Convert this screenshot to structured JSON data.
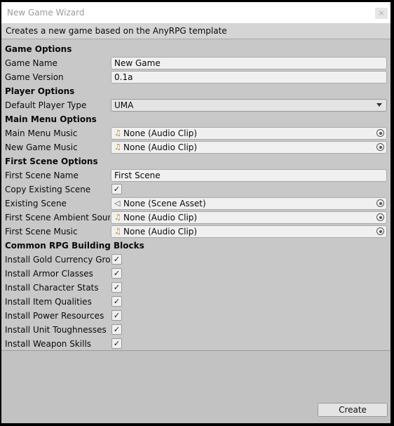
{
  "window": {
    "title": "New Game Wizard",
    "close_label": "×"
  },
  "help_text": "Creates a new game based on the AnyRPG template",
  "sections": {
    "game_options": "Game Options",
    "player_options": "Player Options",
    "main_menu_options": "Main Menu Options",
    "first_scene_options": "First Scene Options",
    "building_blocks": "Common RPG Building Blocks"
  },
  "fields": {
    "game_name": {
      "label": "Game Name",
      "value": "New Game"
    },
    "game_version": {
      "label": "Game Version",
      "value": "0.1a"
    },
    "default_player_type": {
      "label": "Default Player Type",
      "value": "UMA"
    },
    "main_menu_music": {
      "label": "Main Menu Music",
      "value": "None (Audio Clip)"
    },
    "new_game_music": {
      "label": "New Game Music",
      "value": "None (Audio Clip)"
    },
    "first_scene_name": {
      "label": "First Scene Name",
      "value": "First Scene"
    },
    "copy_existing_scene": {
      "label": "Copy Existing Scene",
      "checked": true
    },
    "existing_scene": {
      "label": "Existing Scene",
      "value": "None (Scene Asset)"
    },
    "first_scene_ambient": {
      "label": "First Scene Ambient Sounds",
      "value": "None (Audio Clip)"
    },
    "first_scene_music": {
      "label": "First Scene Music",
      "value": "None (Audio Clip)"
    }
  },
  "building_blocks": [
    {
      "label": "Install Gold Currency Group",
      "checked": true
    },
    {
      "label": "Install Armor Classes",
      "checked": true
    },
    {
      "label": "Install Character Stats",
      "checked": true
    },
    {
      "label": "Install Item Qualities",
      "checked": true
    },
    {
      "label": "Install Power Resources",
      "checked": true
    },
    {
      "label": "Install Unit Toughnesses",
      "checked": true
    },
    {
      "label": "Install Weapon Skills",
      "checked": true
    }
  ],
  "checkmark": "✓",
  "icons": {
    "audio": "music-note-icon",
    "scene": "unity-scene-icon",
    "picker": "object-picker-icon"
  },
  "create_label": "Create"
}
